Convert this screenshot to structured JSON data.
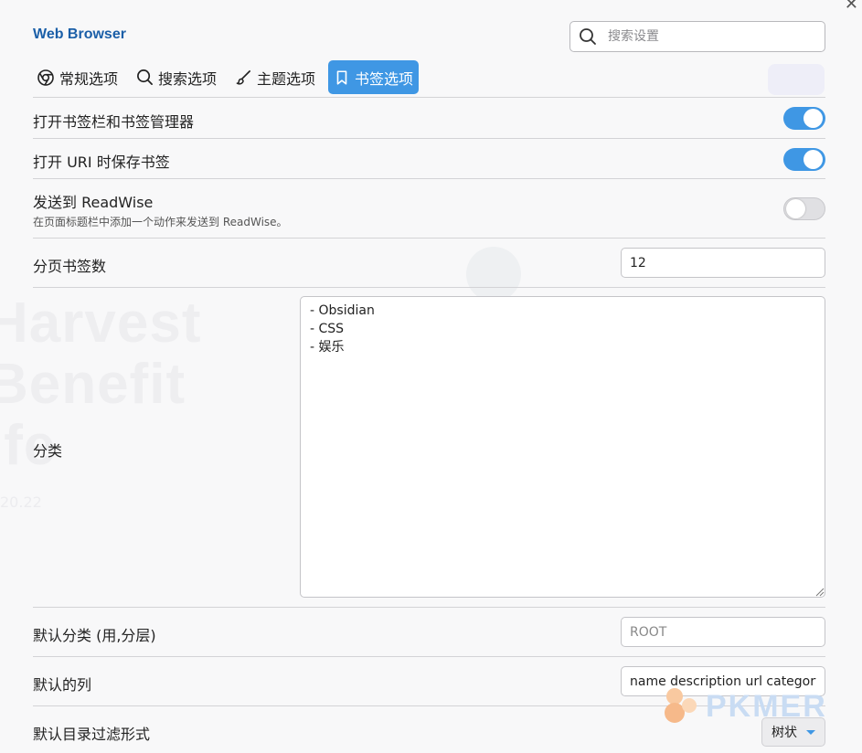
{
  "window": {
    "title": "Web Browser",
    "close_glyph": "✕"
  },
  "search": {
    "placeholder": "搜索设置",
    "icon": "search-icon"
  },
  "tabs": [
    {
      "label": "常规选项",
      "icon": "chrome-icon",
      "active": false
    },
    {
      "label": "搜索选项",
      "icon": "search-icon",
      "active": false
    },
    {
      "label": "主题选项",
      "icon": "brush-icon",
      "active": false
    },
    {
      "label": "书签选项",
      "icon": "bookmark-icon",
      "active": true
    }
  ],
  "settings": {
    "open_bookmark_bar": {
      "label": "打开书签栏和书签管理器",
      "enabled": true
    },
    "save_bookmark_on_uri": {
      "label": "打开 URI 时保存书签",
      "enabled": true
    },
    "send_readwise": {
      "label": "发送到 ReadWise",
      "description": "在页面标题栏中添加一个动作来发送到 ReadWise。",
      "enabled": false
    },
    "bookmarks_per_page": {
      "label": "分页书签数",
      "value": "12"
    },
    "categories": {
      "label": "分类",
      "value": "- Obsidian\n- CSS\n- 娱乐"
    },
    "default_category": {
      "label": "默认分类 (用,分层)",
      "placeholder": "ROOT"
    },
    "default_columns": {
      "label": "默认的列",
      "value": "name description url category"
    },
    "default_filter": {
      "label": "默认目录过滤形式",
      "selected": "树状"
    }
  },
  "colors": {
    "accent": "#3f97e4",
    "title": "#1b5fa8",
    "toggle_off": "#e0e0e3"
  },
  "watermark": {
    "text": "PKMER"
  }
}
